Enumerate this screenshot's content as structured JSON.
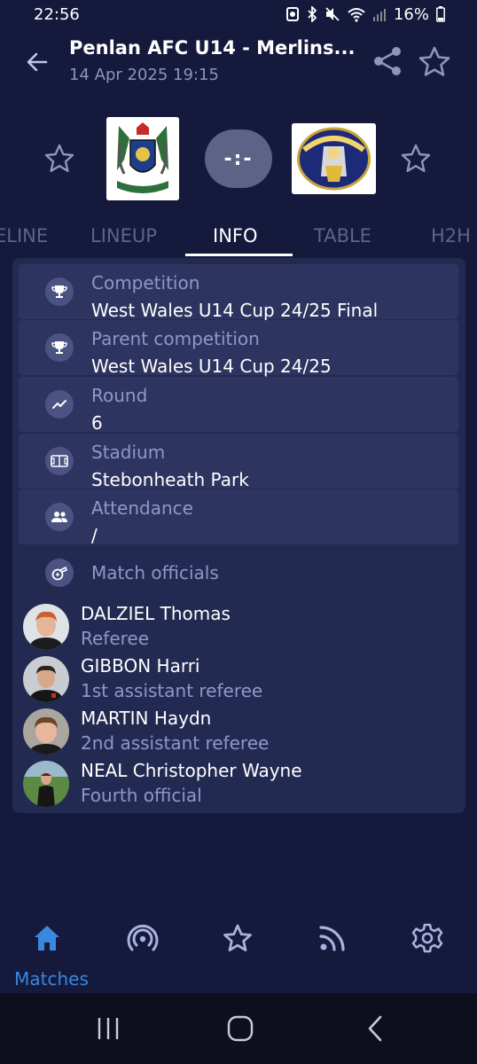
{
  "status": {
    "time": "22:56",
    "battery": "16%"
  },
  "header": {
    "title": "Penlan AFC U14 - Merlins...",
    "datetime": "14 Apr 2025 19:15",
    "icons": [
      "back-arrow-icon",
      "share-icon",
      "star-outline-icon"
    ]
  },
  "match": {
    "score": "-:-",
    "home_crest_text": "PENLAN 2006 A.F.C",
    "away_crest_text": "MERLINS BRIDGE A.F.C."
  },
  "tabs": [
    {
      "label": "ELINE"
    },
    {
      "label": "LINEUP"
    },
    {
      "label": "INFO"
    },
    {
      "label": "TABLE"
    },
    {
      "label": "H2H"
    }
  ],
  "info": {
    "competition": {
      "label": "Competition",
      "value": "West Wales U14 Cup 24/25 Final",
      "icon": "trophy-icon"
    },
    "parent_competition": {
      "label": "Parent competition",
      "value": "West Wales U14 Cup 24/25",
      "icon": "trophy-icon"
    },
    "round": {
      "label": "Round",
      "value": "6",
      "icon": "trend-icon"
    },
    "stadium": {
      "label": "Stadium",
      "value": "Stebonheath Park",
      "icon": "pitch-icon"
    },
    "attendance": {
      "label": "Attendance",
      "value": "/",
      "icon": "people-icon"
    },
    "officials_label": "Match officials"
  },
  "officials": [
    {
      "name": "DALZIEL Thomas",
      "role": "Referee"
    },
    {
      "name": "GIBBON Harri",
      "role": "1st assistant referee"
    },
    {
      "name": "MARTIN Haydn",
      "role": "2nd assistant referee"
    },
    {
      "name": "NEAL Christopher Wayne",
      "role": "Fourth official"
    }
  ],
  "nav": {
    "matches": "Matches",
    "items": [
      "home-icon",
      "live-icon",
      "favourites-icon",
      "feed-icon",
      "settings-icon"
    ]
  },
  "colors": {
    "background": "#15193b",
    "card": "#232a52",
    "row": "#2d3460",
    "accent": "#3a87e0",
    "muted_text": "#8f97c7"
  }
}
